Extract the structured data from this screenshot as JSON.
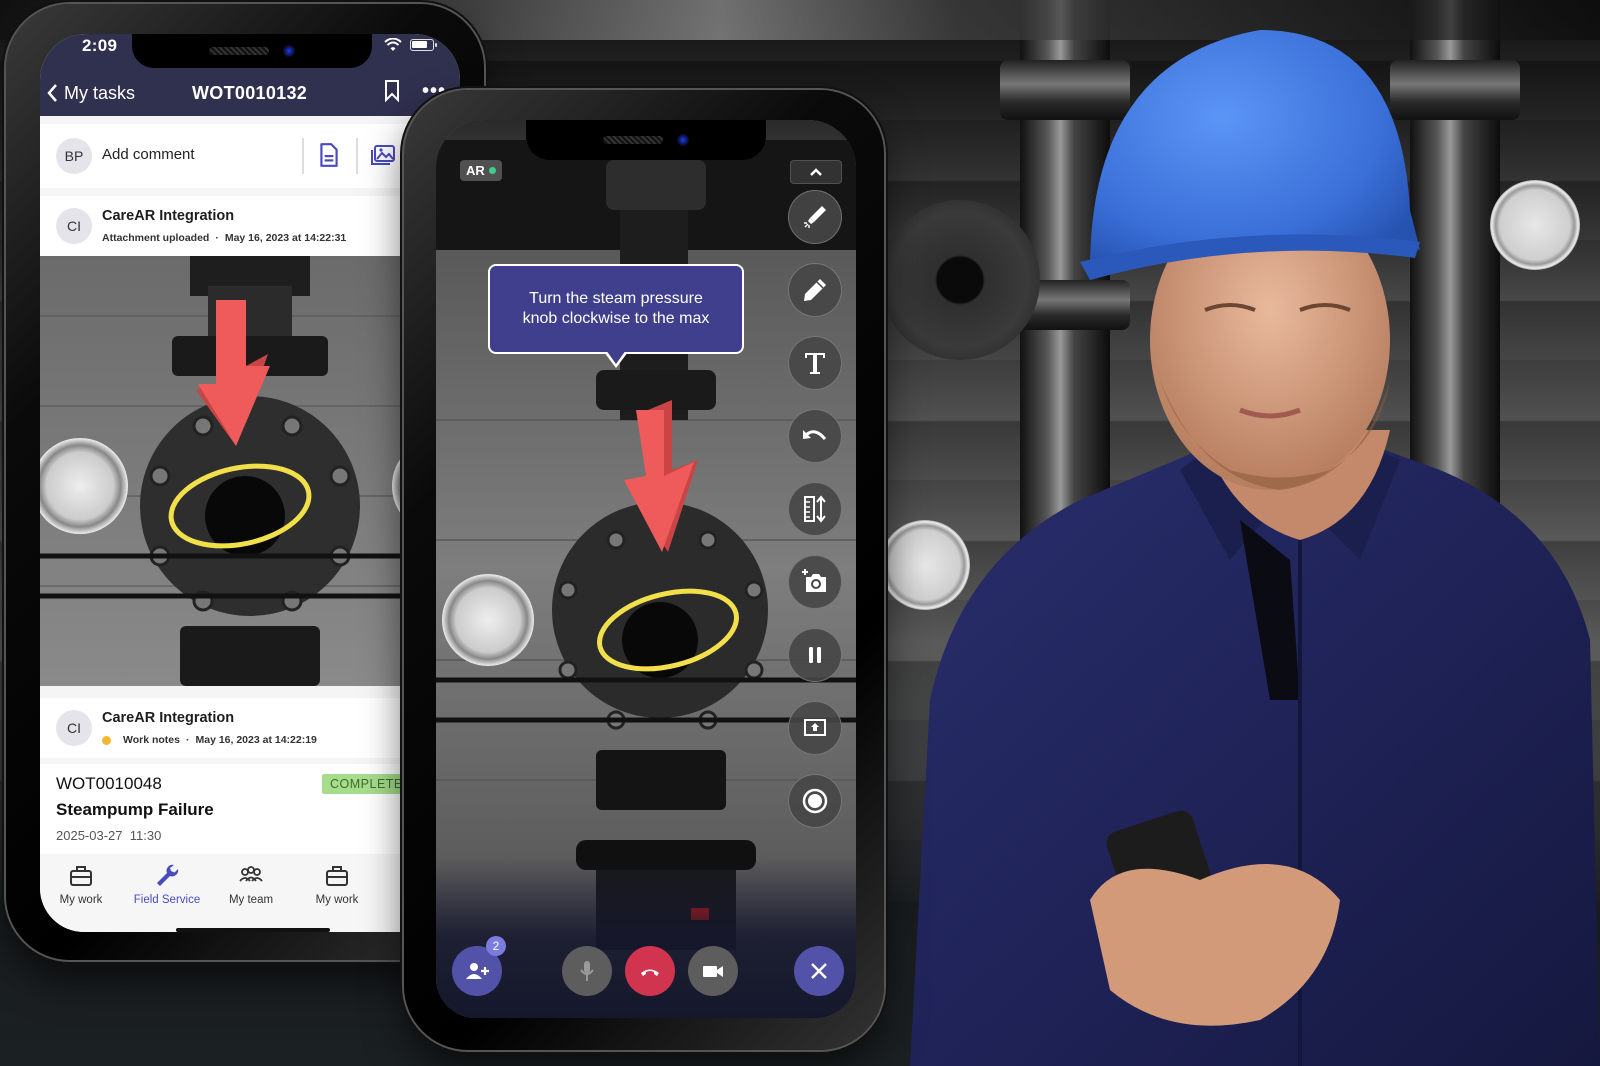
{
  "colors": {
    "header_bg": "#30304f",
    "accent": "#4a4ac0",
    "badge_bg": "#a6dd8c",
    "badge_text": "#3f6b2c",
    "tooltip_bg": "#3f3f8e",
    "end_call": "#d1344f",
    "ar_dot": "#3ccf8e",
    "work_notes_dot": "#f5b730",
    "annotation_arrow": "#ef5a5a",
    "annotation_circle": "#f2e04a"
  },
  "tasks_phone": {
    "status_bar": {
      "time": "2:09"
    },
    "nav": {
      "back_label": "My tasks",
      "title": "WOT0010132",
      "bookmark_icon": "bookmark-icon",
      "more_icon": "more-icon"
    },
    "comment": {
      "avatar_initials": "BP",
      "placeholder": "Add comment",
      "attach_document_icon": "document-icon",
      "attach_image_icon": "image-gallery-icon"
    },
    "feed": [
      {
        "avatar_initials": "CI",
        "author": "CareAR Integration",
        "type": "Attachment uploaded",
        "separator": "·",
        "timestamp": "May 16, 2023 at 14:22:31"
      },
      {
        "avatar_initials": "CI",
        "author": "CareAR Integration",
        "type": "Work notes",
        "separator": "·",
        "timestamp": "May 16, 2023 at 14:22:19"
      }
    ],
    "work_order": {
      "number": "WOT0010048",
      "status": "COMPLETED",
      "title": "Steampump Failure",
      "date": "2025-03-27",
      "time": "11:30"
    },
    "tabbar": [
      {
        "label": "My work",
        "icon": "briefcase-icon",
        "active": false
      },
      {
        "label": "Field Service",
        "icon": "wrench-icon",
        "active": true
      },
      {
        "label": "My team",
        "icon": "team-icon",
        "active": false
      },
      {
        "label": "My work",
        "icon": "briefcase-icon",
        "active": false
      }
    ]
  },
  "ar_phone": {
    "ar_badge": "AR",
    "tooltip": "Turn the steam pressure knob clockwise to the max",
    "toolbar": [
      {
        "name": "laser-pointer",
        "icon": "laser-pointer-icon"
      },
      {
        "name": "draw",
        "icon": "pencil-icon"
      },
      {
        "name": "text",
        "icon": "text-icon"
      },
      {
        "name": "undo",
        "icon": "undo-icon"
      },
      {
        "name": "measure",
        "icon": "ruler-icon"
      },
      {
        "name": "snapshot",
        "icon": "add-photo-icon"
      },
      {
        "name": "pause",
        "icon": "pause-icon"
      },
      {
        "name": "share-screen",
        "icon": "screen-share-icon"
      },
      {
        "name": "record",
        "icon": "record-icon"
      }
    ],
    "call_controls": {
      "participants_count": "2",
      "add_participant_icon": "add-person-icon",
      "mic_icon": "microphone-icon",
      "end_call_icon": "phone-hangup-icon",
      "video_icon": "video-camera-icon",
      "close_icon": "close-icon"
    }
  }
}
